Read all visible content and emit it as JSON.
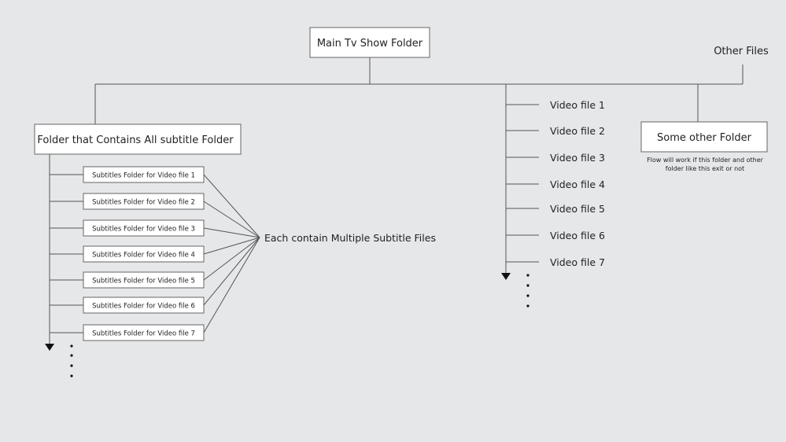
{
  "colors": {
    "background": "#e6e7e9",
    "line": "#555555",
    "box": "#ffffff"
  },
  "root": {
    "label": "Main Tv Show Folder"
  },
  "other_files": {
    "label": "Other Files"
  },
  "subtitle_folder": {
    "label": "Folder that Contains All subtitle Folder",
    "children": [
      "Subtitles Folder for Video file 1",
      "Subtitles Folder for Video file 2",
      "Subtitles Folder for Video file 3",
      "Subtitles Folder for Video file 4",
      "Subtitles Folder for Video file 5",
      "Subtitles Folder for Video file 6",
      "Subtitles Folder for Video file 7"
    ],
    "annotation": "Each contain Multiple Subtitle Files"
  },
  "video_files": [
    "Video file 1",
    "Video file 2",
    "Video file 3",
    "Video file 4",
    "Video file 5",
    "Video file 6",
    "Video file 7"
  ],
  "other_folder": {
    "label": "Some other Folder",
    "note_line1": "Flow will work if this folder and other",
    "note_line2": "folder like this exit or not"
  }
}
